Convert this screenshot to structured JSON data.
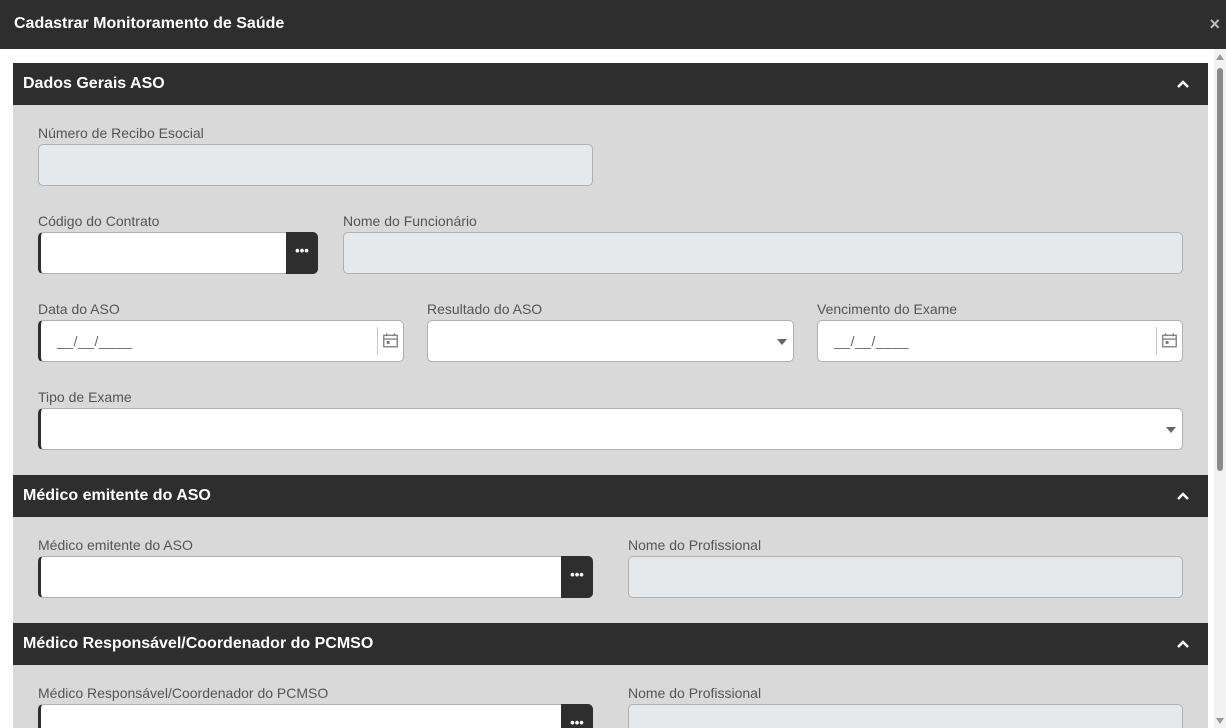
{
  "window": {
    "title": "Cadastrar Monitoramento de Saúde",
    "close_symbol": "×"
  },
  "lookup_symbol": "•••",
  "date_mask": "__/__/____",
  "sections": {
    "dados_gerais": {
      "title": "Dados Gerais ASO",
      "recibo_label": "Número de Recibo Esocial",
      "recibo_value": "",
      "contrato_label": "Código do Contrato",
      "contrato_value": "",
      "funcionario_label": "Nome do Funcionário",
      "funcionario_value": "",
      "data_aso_label": "Data do ASO",
      "resultado_label": "Resultado do ASO",
      "resultado_value": "",
      "vencimento_label": "Vencimento do Exame",
      "tipo_exame_label": "Tipo de Exame",
      "tipo_exame_value": ""
    },
    "medico_emitente": {
      "title": "Médico emitente do ASO",
      "medico_label": "Médico emitente do ASO",
      "medico_value": "",
      "profissional_label": "Nome do Profissional",
      "profissional_value": ""
    },
    "medico_responsavel": {
      "title": "Médico Responsável/Coordenador do PCMSO",
      "medico_label": "Médico Responsável/Coordenador do PCMSO",
      "medico_value": "",
      "profissional_label": "Nome do Profissional",
      "profissional_value": ""
    }
  }
}
